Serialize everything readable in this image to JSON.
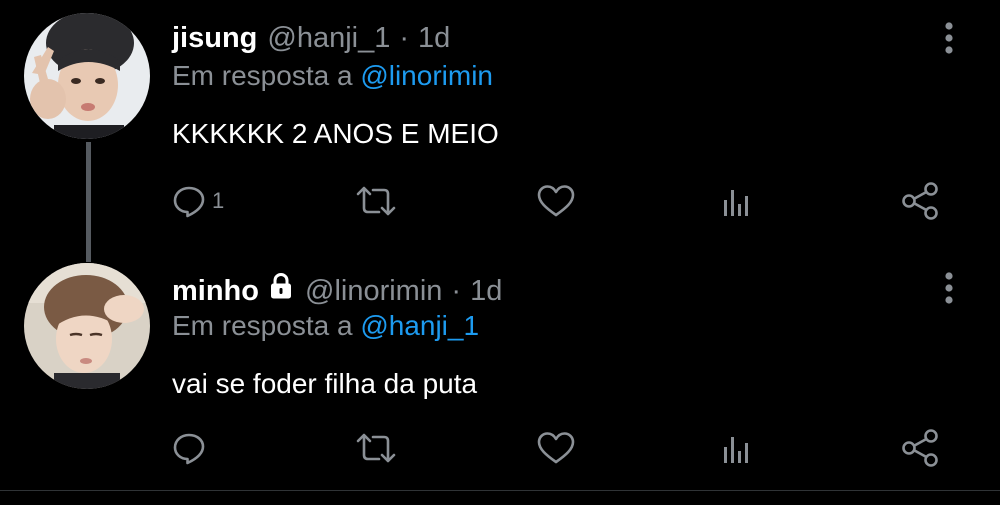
{
  "colors": {
    "background": "#000000",
    "text": "#ffffff",
    "muted": "#8b9096",
    "link": "#1d9bf0",
    "thread_line": "#555a60"
  },
  "tweets": [
    {
      "name": "jisung",
      "handle": "@hanji_1",
      "separator": "·",
      "time": "1d",
      "reply_prefix": "Em resposta a",
      "reply_to": "@linorimin",
      "text": "KKKKKK 2 ANOS E MEIO",
      "protected": false,
      "icons": {
        "reply": "reply-icon",
        "retweet": "retweet-icon",
        "like": "heart-icon",
        "stats": "stats-icon",
        "share": "share-icon",
        "more": "more-vertical-icon"
      },
      "reply_count": "1"
    },
    {
      "name": "minho",
      "handle": "@linorimin",
      "separator": "·",
      "time": "1d",
      "reply_prefix": "Em resposta a",
      "reply_to": "@hanji_1",
      "text": "vai se foder filha da puta",
      "protected": true,
      "icons": {
        "reply": "reply-icon",
        "retweet": "retweet-icon",
        "like": "heart-icon",
        "stats": "stats-icon",
        "share": "share-icon",
        "more": "more-vertical-icon",
        "lock": "lock-icon"
      },
      "reply_count": ""
    }
  ]
}
